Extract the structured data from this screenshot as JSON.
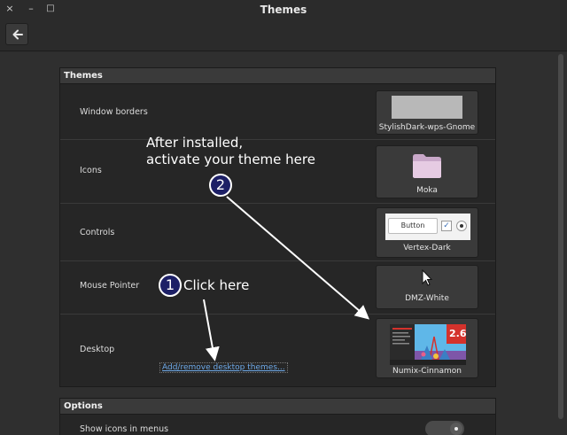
{
  "window": {
    "title": "Themes",
    "close_glyph": "×",
    "minimize_glyph": "–",
    "maximize_glyph": "□"
  },
  "sections": {
    "themes": {
      "heading": "Themes",
      "rows": [
        {
          "label": "Window borders",
          "value": "StylishDark-wps-Gnome"
        },
        {
          "label": "Icons",
          "value": "Moka"
        },
        {
          "label": "Controls",
          "value": "Vertex-Dark"
        },
        {
          "label": "Mouse Pointer",
          "value": "DMZ-White"
        },
        {
          "label": "Desktop",
          "value": "Numix-Cinnamon"
        }
      ],
      "desktop_link": "Add/remove desktop themes...",
      "controls_preview_button": "Button",
      "desktop_preview_version": "2.6"
    },
    "options": {
      "heading": "Options",
      "rows": [
        {
          "label": "Show icons in menus",
          "toggle": true
        }
      ]
    }
  },
  "annotations": {
    "step1_number": "1",
    "step1_text": "Click here",
    "step2_number": "2",
    "step2_line1": "After installed,",
    "step2_line2": "activate your theme here"
  },
  "colors": {
    "background": "#2f2f2f",
    "panel": "#262626",
    "link": "#6ea9e8",
    "badge": "#1d2066",
    "numix_red": "#d4322c"
  }
}
